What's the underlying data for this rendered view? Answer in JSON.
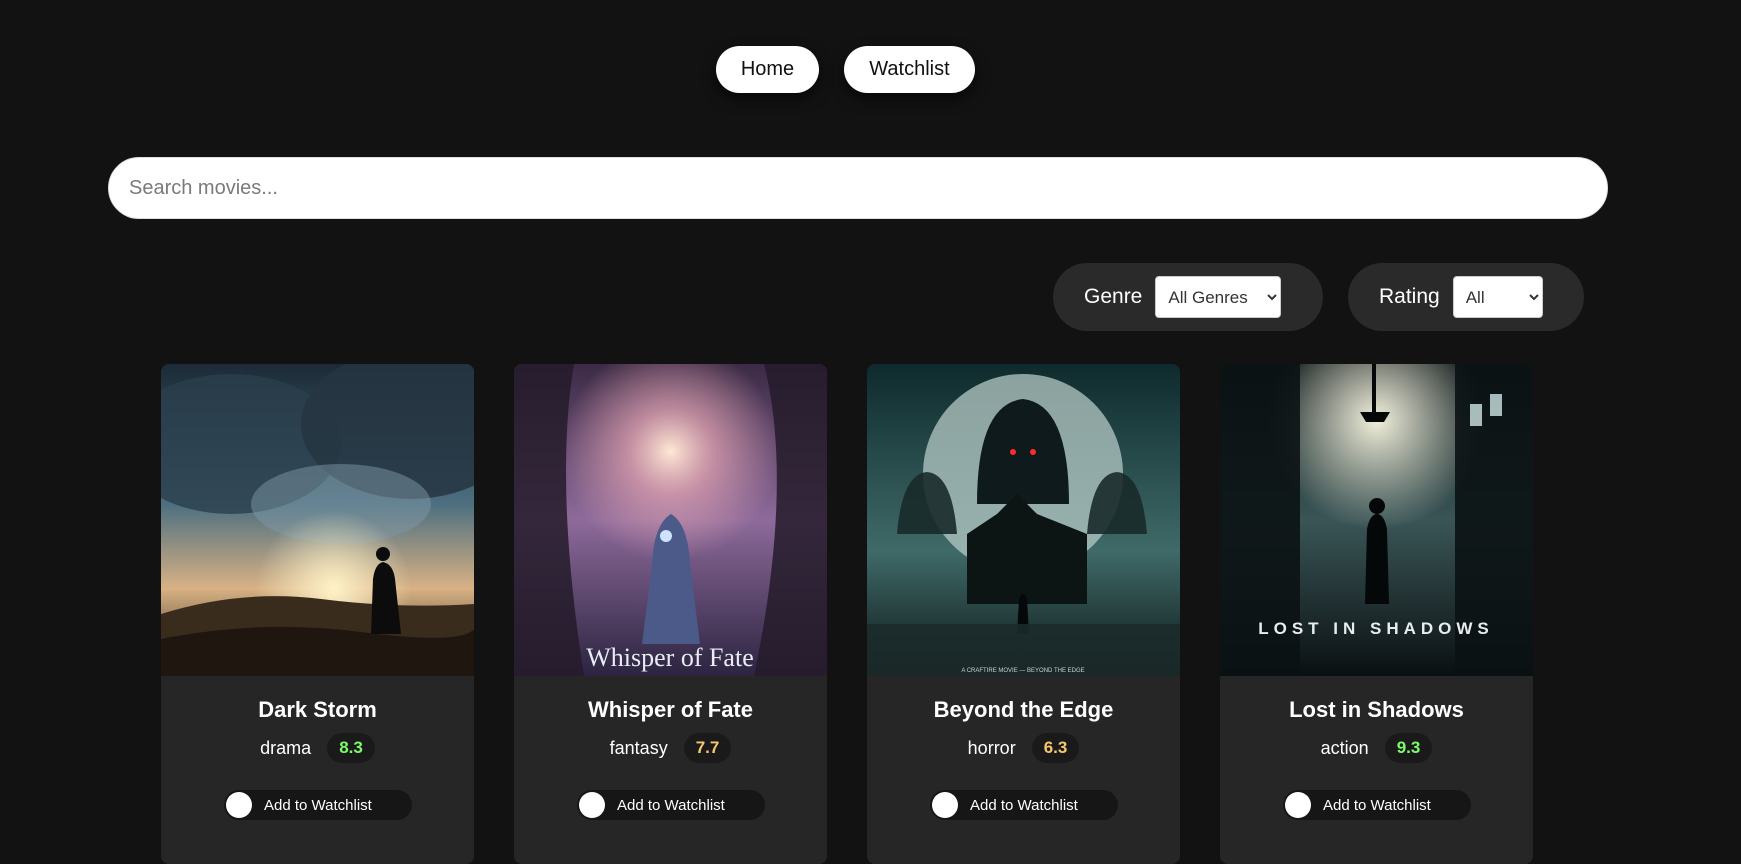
{
  "nav": {
    "home_label": "Home",
    "watchlist_label": "Watchlist"
  },
  "search": {
    "placeholder": "Search movies..."
  },
  "filters": {
    "genre_label": "Genre",
    "genre_selected": "All Genres",
    "rating_label": "Rating",
    "rating_selected": "All"
  },
  "movies": [
    {
      "title": "Dark Storm",
      "genre": "drama",
      "rating": "8.3",
      "rating_color": "#7CFC6A",
      "toggle_label": "Add to Watchlist",
      "poster_title": ""
    },
    {
      "title": "Whisper of Fate",
      "genre": "fantasy",
      "rating": "7.7",
      "rating_color": "#F5C96B",
      "toggle_label": "Add to Watchlist",
      "poster_title": "Whisper of Fate"
    },
    {
      "title": "Beyond the Edge",
      "genre": "horror",
      "rating": "6.3",
      "rating_color": "#F5C96B",
      "toggle_label": "Add to Watchlist",
      "poster_title": "A CRAFTIRE MOVIE — BEYOND THE EDGE"
    },
    {
      "title": "Lost in Shadows",
      "genre": "action",
      "rating": "9.3",
      "rating_color": "#7CFC6A",
      "toggle_label": "Add to Watchlist",
      "poster_title": "LOST IN SHADOWS"
    }
  ]
}
